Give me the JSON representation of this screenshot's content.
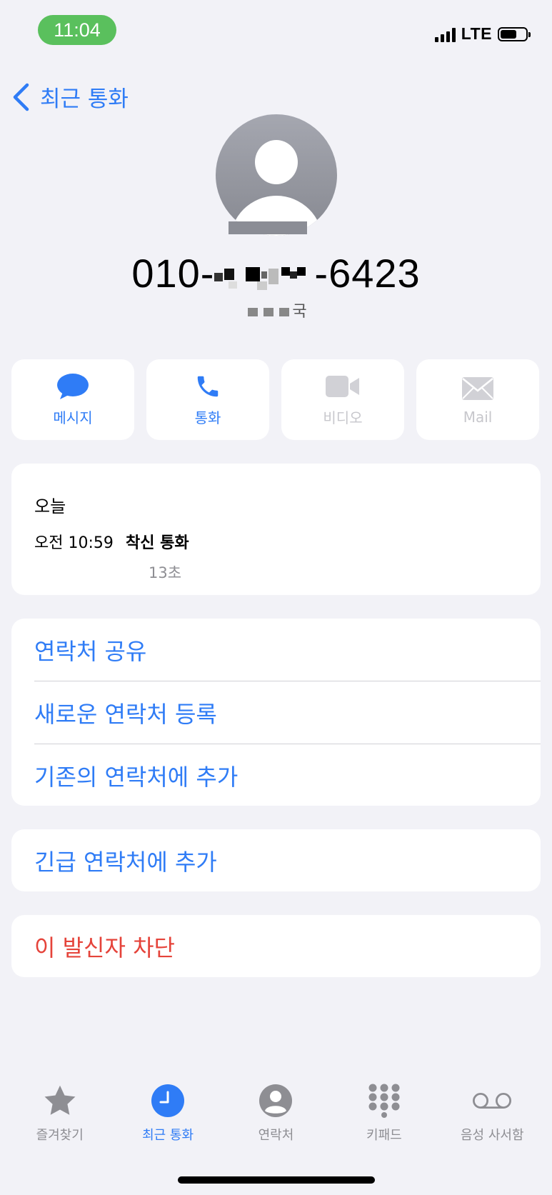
{
  "status": {
    "time": "11:04",
    "network": "LTE"
  },
  "nav": {
    "back_label": "최근 통화"
  },
  "contact": {
    "number_prefix": "010-",
    "number_suffix": "-6423",
    "location_suffix": "국"
  },
  "actions": [
    {
      "label": "메시지",
      "icon": "message-icon",
      "enabled": true
    },
    {
      "label": "통화",
      "icon": "phone-icon",
      "enabled": true
    },
    {
      "label": "비디오",
      "icon": "video-icon",
      "enabled": false
    },
    {
      "label": "Mail",
      "icon": "mail-icon",
      "enabled": false
    }
  ],
  "history": {
    "day": "오늘",
    "time": "오전 10:59",
    "type": "착신 통화",
    "duration": "13초"
  },
  "menu": {
    "share_contact": "연락처 공유",
    "new_contact": "새로운 연락처 등록",
    "add_existing": "기존의 연락처에 추가",
    "add_emergency": "긴급 연락처에 추가",
    "block_caller": "이 발신자 차단"
  },
  "tabs": [
    {
      "label": "즐겨찾기",
      "icon": "star-icon",
      "active": false
    },
    {
      "label": "최근 통화",
      "icon": "clock-icon",
      "active": true
    },
    {
      "label": "연락처",
      "icon": "person-icon",
      "active": false
    },
    {
      "label": "키패드",
      "icon": "keypad-icon",
      "active": false
    },
    {
      "label": "음성 사서함",
      "icon": "voicemail-icon",
      "active": false
    }
  ],
  "colors": {
    "accent": "#2f7cf6",
    "destructive": "#e5433a",
    "status_green": "#5ac05d",
    "background": "#f2f2f7"
  },
  "battery_level": 0.65
}
